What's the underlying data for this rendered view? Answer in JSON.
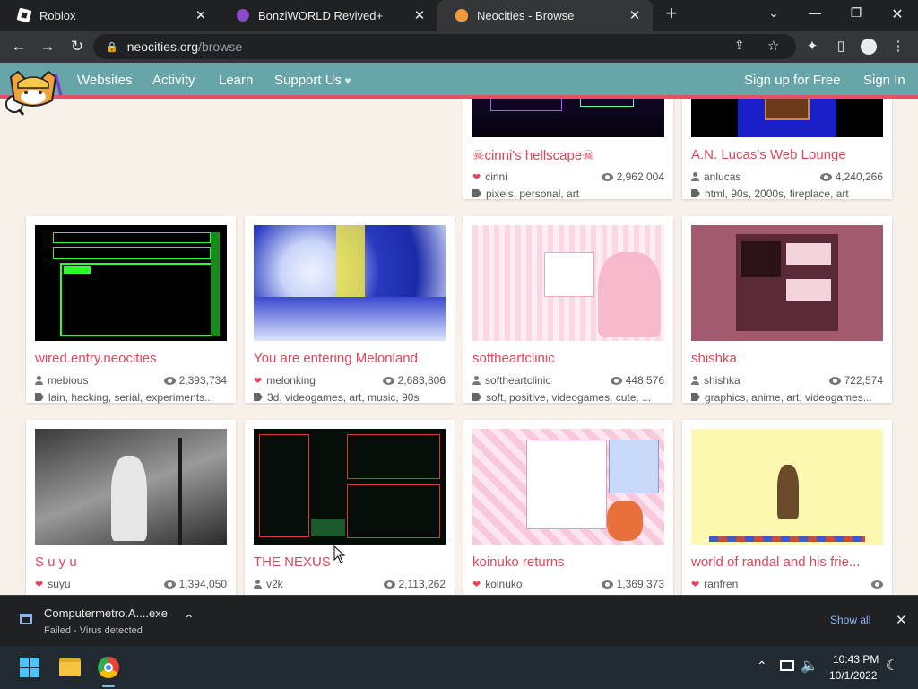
{
  "tabs": [
    {
      "title": "Roblox",
      "icon": "roblox-icon",
      "active": false
    },
    {
      "title": "BonziWORLD Revived+",
      "icon": "bonzi-icon",
      "active": false
    },
    {
      "title": "Neocities - Browse",
      "icon": "neocities-icon",
      "active": true
    }
  ],
  "address": {
    "domain": "neocities.org",
    "path": "/browse"
  },
  "neocities": {
    "nav": [
      "Websites",
      "Activity",
      "Learn",
      "Support Us"
    ],
    "signup": "Sign up for Free",
    "signin": "Sign In"
  },
  "sites": [
    {
      "title": "☠cinni's hellscape☠",
      "user": "cinni",
      "heart": true,
      "views": "2,962,004",
      "tags": "pixels, personal, art"
    },
    {
      "title": "A.N. Lucas's Web Lounge",
      "user": "anlucas",
      "heart": false,
      "views": "4,240,266",
      "tags": "html, 90s, 2000s, fireplace, art"
    },
    {
      "title": "wired.entry.neocities",
      "user": "mebious",
      "heart": false,
      "views": "2,393,734",
      "tags": "lain, hacking, serial, experiments..."
    },
    {
      "title": "You are entering Melonland",
      "user": "melonking",
      "heart": true,
      "views": "2,683,806",
      "tags": "3d, videogames, art, music, 90s"
    },
    {
      "title": "softheartclinic",
      "user": "softheartclinic",
      "heart": false,
      "views": "448,576",
      "tags": "soft, positive, videogames, cute, ..."
    },
    {
      "title": "shishka",
      "user": "shishka",
      "heart": false,
      "views": "722,574",
      "tags": "graphics, anime, art, videogames..."
    },
    {
      "title": "S u y u",
      "user": "suyu",
      "heart": true,
      "views": "1,394,050",
      "tags": ""
    },
    {
      "title": "THE NEXUS",
      "user": "v2k",
      "heart": false,
      "views": "2,113,262",
      "tags": ""
    },
    {
      "title": "koinuko returns",
      "user": "koinuko",
      "heart": true,
      "views": "1,369,373",
      "tags": ""
    },
    {
      "title": "world of randal and his frie...",
      "user": "ranfren",
      "heart": true,
      "views": "",
      "tags": ""
    }
  ],
  "download": {
    "filename": "Computermetro.A....exe",
    "status": "Failed - Virus detected",
    "show_all": "Show all"
  },
  "taskbar": {
    "time": "10:43 PM",
    "date": "10/1/2022"
  }
}
